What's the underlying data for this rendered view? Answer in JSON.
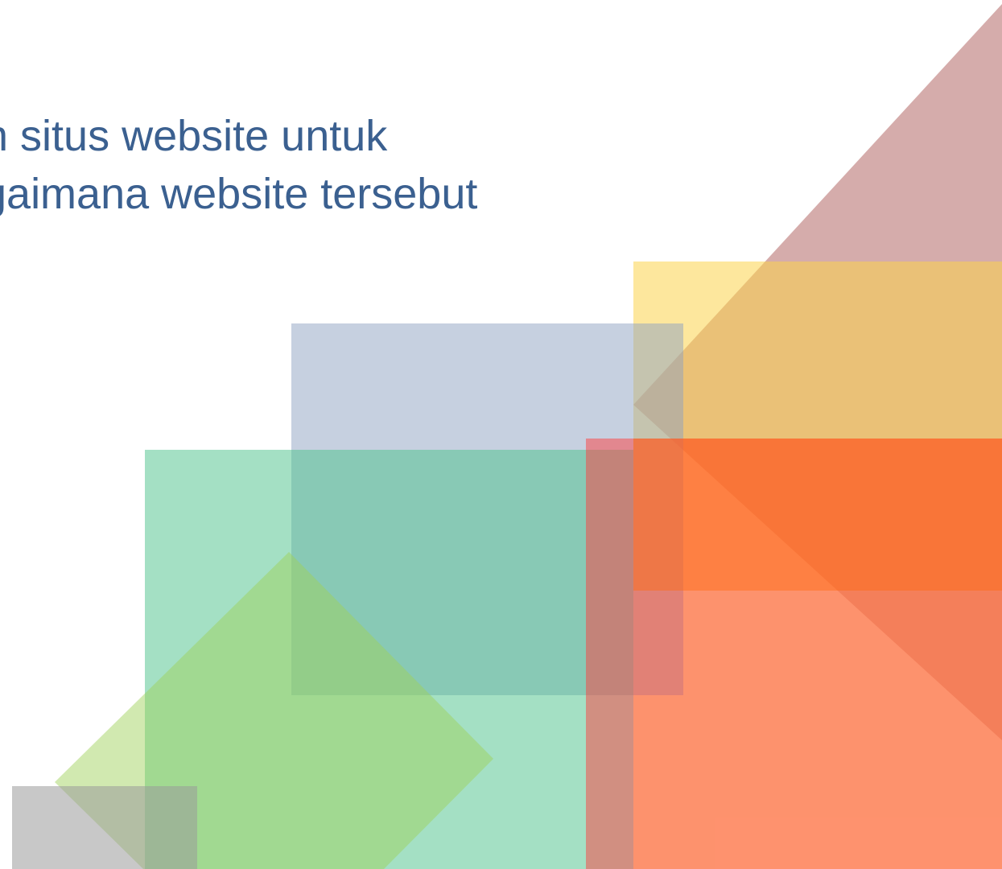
{
  "slide": {
    "text_lines": [
      "n situs website untuk",
      "gaimana website tersebut"
    ]
  },
  "colors": {
    "text": "#3b6090",
    "triangle_mauve": "#b56d6c",
    "rect_yellow": "#fcd34d",
    "rect_blue": "#8ea2c2",
    "rect_green": "#49c18a",
    "rect_red": "#fe3e3e",
    "band_orange": "#ff6a10",
    "diamond_lime": "#9fd25a",
    "rect_gray": "#9a9a9a"
  }
}
